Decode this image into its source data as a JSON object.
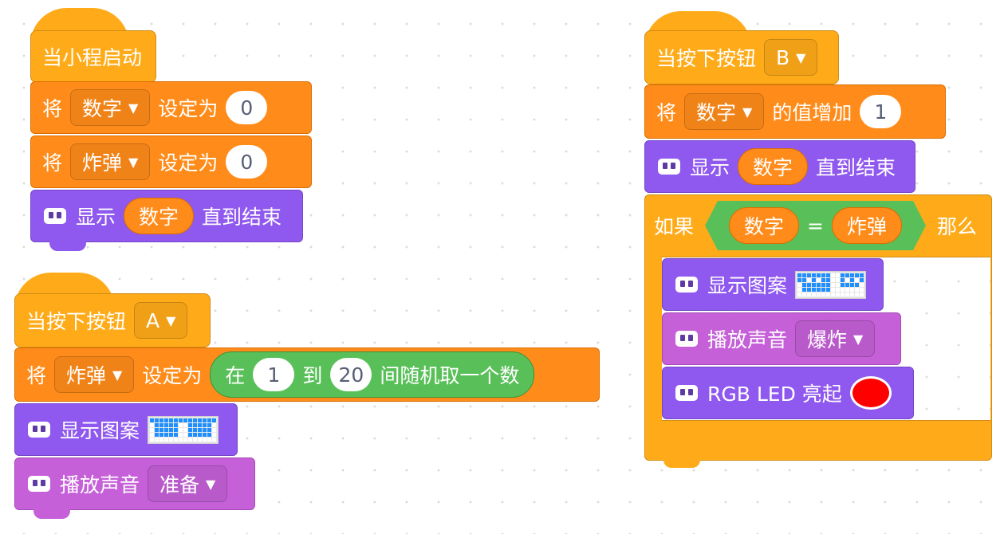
{
  "script1": {
    "hat_label": "当小程启动",
    "set1": {
      "prefix": "将",
      "var": "数字",
      "mid": "设定为",
      "value": "0"
    },
    "set2": {
      "prefix": "将",
      "var": "炸弹",
      "mid": "设定为",
      "value": "0"
    },
    "show": {
      "prefix": "显示",
      "reporter": "数字",
      "suffix": "直到结束"
    }
  },
  "script2": {
    "hat_label": "当按下按钮",
    "button": "A",
    "set": {
      "prefix": "将",
      "var": "炸弹",
      "mid": "设定为",
      "rand_prefix": "在",
      "from": "1",
      "to_label": "到",
      "to": "20",
      "rand_suffix": "间随机取一个数"
    },
    "show_image": {
      "label": "显示图案"
    },
    "play_sound": {
      "label": "播放声音",
      "sound": "准备"
    }
  },
  "script3": {
    "hat_label": "当按下按钮",
    "button": "B",
    "change": {
      "prefix": "将",
      "var": "数字",
      "mid": "的值增加",
      "value": "1"
    },
    "show": {
      "prefix": "显示",
      "reporter": "数字",
      "suffix": "直到结束"
    },
    "if": {
      "label": "如果",
      "left": "数字",
      "op": "=",
      "right": "炸弹",
      "then": "那么"
    },
    "show_image": {
      "label": "显示图案"
    },
    "play_sound": {
      "label": "播放声音",
      "sound": "爆炸"
    },
    "led": {
      "label": "RGB LED 亮起",
      "color": "#ff0000"
    }
  },
  "icons": {
    "dropdown": "chevron-down-icon",
    "robot": "robot-icon"
  },
  "colors": {
    "events": "#ffab19",
    "variables": "#ff8c1a",
    "ev3": "#8f58ee",
    "sound": "#c560d8",
    "operators": "#59c059"
  }
}
